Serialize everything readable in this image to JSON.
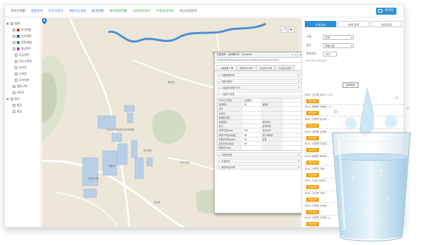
{
  "topnav": {
    "items": [
      {
        "label": "지하수현황",
        "style": "normal"
      },
      {
        "label": "관정검색",
        "style": "active"
      },
      {
        "label": "인허가관리",
        "style": "active"
      },
      {
        "label": "개발가능검토",
        "style": "active"
      },
      {
        "label": "통계현황",
        "style": "active"
      },
      {
        "label": "복귀위탁현황",
        "style": "green"
      },
      {
        "label": "사후관리관리",
        "style": "green"
      },
      {
        "label": "수질검사이력",
        "style": "green"
      },
      {
        "label": "하선고관관리",
        "style": "normal"
      }
    ],
    "admin_label": "관리자"
  },
  "layers": [
    {
      "label": "범례",
      "indent": 0,
      "color": "",
      "expand": "▣"
    },
    {
      "label": "허가관정",
      "indent": 1,
      "color": "#e03030",
      "expand": ""
    },
    {
      "label": "신고관정",
      "indent": 1,
      "color": "#3050d0",
      "expand": ""
    },
    {
      "label": "휴정/폐공",
      "indent": 1,
      "color": "#20a040",
      "expand": ""
    },
    {
      "label": "원상복구",
      "indent": 1,
      "color": "#b040c0",
      "expand": ""
    },
    {
      "label": "공공관정",
      "indent": 2,
      "color": "",
      "expand": ""
    },
    {
      "label": "유니스관정",
      "indent": 2,
      "color": "",
      "expand": ""
    },
    {
      "label": "농어촌",
      "indent": 2,
      "color": "",
      "expand": ""
    },
    {
      "label": "소하천",
      "indent": 2,
      "color": "",
      "expand": ""
    },
    {
      "label": "국가하천",
      "indent": 2,
      "color": "",
      "expand": ""
    },
    {
      "label": "행정구역",
      "indent": 1,
      "color": "",
      "expand": ""
    },
    {
      "label": "지적도",
      "indent": 1,
      "color": "",
      "expand": ""
    },
    {
      "label": "바다",
      "indent": 0,
      "color": "",
      "expand": "▣"
    },
    {
      "label": "항공",
      "indent": 1,
      "color": "",
      "expand": ""
    },
    {
      "label": "영상",
      "indent": 1,
      "color": "",
      "expand": ""
    }
  ],
  "map": {
    "labels": [
      {
        "text": "CHA의과학대학교부속병원",
        "key": "hospital"
      },
      {
        "text": "해봉로",
        "key": "road1"
      },
      {
        "text": "KBC방송",
        "key": "kbc"
      },
      {
        "text": "원암로",
        "key": "road2"
      },
      {
        "text": "학교법인",
        "key": "school"
      },
      {
        "text": "안심로",
        "key": "road3"
      },
      {
        "text": "식품연구원",
        "key": "lab"
      },
      {
        "text": "솔로몬애",
        "key": "apt"
      },
      {
        "text": "인천대학교",
        "key": "univ"
      }
    ],
    "tools": [
      "⤢",
      "➤"
    ]
  },
  "popup": {
    "title": "관정정보 - 상세페이지 - Chrome",
    "address": "localhost:8080/gosan/map/amnsoftpInfo.do?amnonDiv=",
    "tabs": [
      {
        "label": "시설현황/기록",
        "active": true
      },
      {
        "label": "정밀조사/DB",
        "active": false
      },
      {
        "label": "수질검사이력",
        "active": false
      },
      {
        "label": "수질검사결과",
        "active": false
      }
    ],
    "sections_top": [
      "사용현황조회",
      "개발이용자",
      "시설설치내용(허가)"
    ],
    "sub_section": "시설공기내용",
    "grid": [
      [
        "허가/신고번호",
        "농업용수",
        "",
        ""
      ],
      [
        "세부용도",
        "32",
        "불용도",
        ""
      ],
      [
        "심도",
        "",
        "",
        ""
      ],
      [
        "소재지",
        "-",
        "",
        ""
      ],
      [
        "등록점 명칭",
        "-",
        "",
        ""
      ],
      [
        "준공일자",
        "-",
        "굴착심도",
        ""
      ],
      [
        "표고",
        "-",
        "굴착직경",
        ""
      ],
      [
        "굴착직경(mm)",
        "200",
        "양수능력",
        ""
      ],
      [
        "토출구직경(㎥/일)",
        "28",
        "취수계획량",
        ""
      ],
      [
        "토출관직경(mm)",
        "40",
        "양정",
        ""
      ],
      [
        "양수능력(㎥/일)",
        "46",
        "",
        ""
      ],
      [
        "해중깊이(m)",
        "",
        "",
        ""
      ]
    ],
    "sections_bottom": [
      "지정표준법",
      "수질검사",
      "행정처분/이력"
    ]
  },
  "panel": {
    "tabs": [
      {
        "label": "시설검색",
        "active": true
      },
      {
        "label": "지번검색",
        "active": false
      },
      {
        "label": "세부검색",
        "active": false
      }
    ],
    "form": [
      {
        "key": "구분",
        "value": "전체",
        "kind": "select"
      },
      {
        "key": "용도",
        "value": "포함시설",
        "kind": "select"
      },
      {
        "key": "관리번호",
        "value": "130",
        "kind": "input"
      }
    ],
    "address_hint": "e.d 101 200-447",
    "search_label": "검색하기",
    "results": [
      {
        "address": "000 / 심관청 420-1 / 인..."
      },
      {
        "address": "000 / 발행면 모바트 / 1-..."
      },
      {
        "address": "000 / 신루면 공사자 ..."
      },
      {
        "address": "000 / 심락면 심남리 ..."
      },
      {
        "address": "000 / 신루면 이신쿠 ..."
      },
      {
        "address": "000 / 발용면 운동리 ..."
      },
      {
        "address": "000 / 신루면 교봉 ..."
      },
      {
        "address": "000 / 24년 이관가 ..."
      },
      {
        "address": "000 / 가선면 가포 ..."
      },
      {
        "address": "000 / 신루면 고토비 ..."
      },
      {
        "address": "000 / 신루면 고임리 1..."
      },
      {
        "address": "000 / 발한면 운정리 19..."
      }
    ],
    "result_button": "관련정보"
  },
  "colors": {
    "accent": "#2f8fd6",
    "river": "#4a8ed6",
    "building": "#b9cfe6",
    "result_button": "#f0a000"
  }
}
